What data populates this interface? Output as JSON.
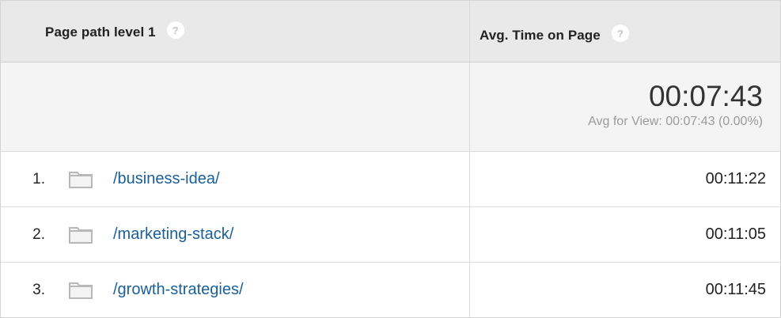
{
  "header": {
    "dimension_label": "Page path level 1",
    "metric_label": "Avg. Time on Page",
    "help_glyph": "?"
  },
  "summary": {
    "value": "00:07:43",
    "avg_for_view": "Avg for View: 00:07:43 (0.00%)"
  },
  "rows": [
    {
      "index": "1.",
      "path": "/business-idea/",
      "time": "00:11:22",
      "icon": "folder-icon"
    },
    {
      "index": "2.",
      "path": "/marketing-stack/",
      "time": "00:11:05",
      "icon": "folder-icon"
    },
    {
      "index": "3.",
      "path": "/growth-strategies/",
      "time": "00:11:45",
      "icon": "folder-icon"
    }
  ],
  "colors": {
    "link": "#1a5f97",
    "header_bg": "#e9e9e9",
    "summary_bg": "#f4f4f4"
  }
}
